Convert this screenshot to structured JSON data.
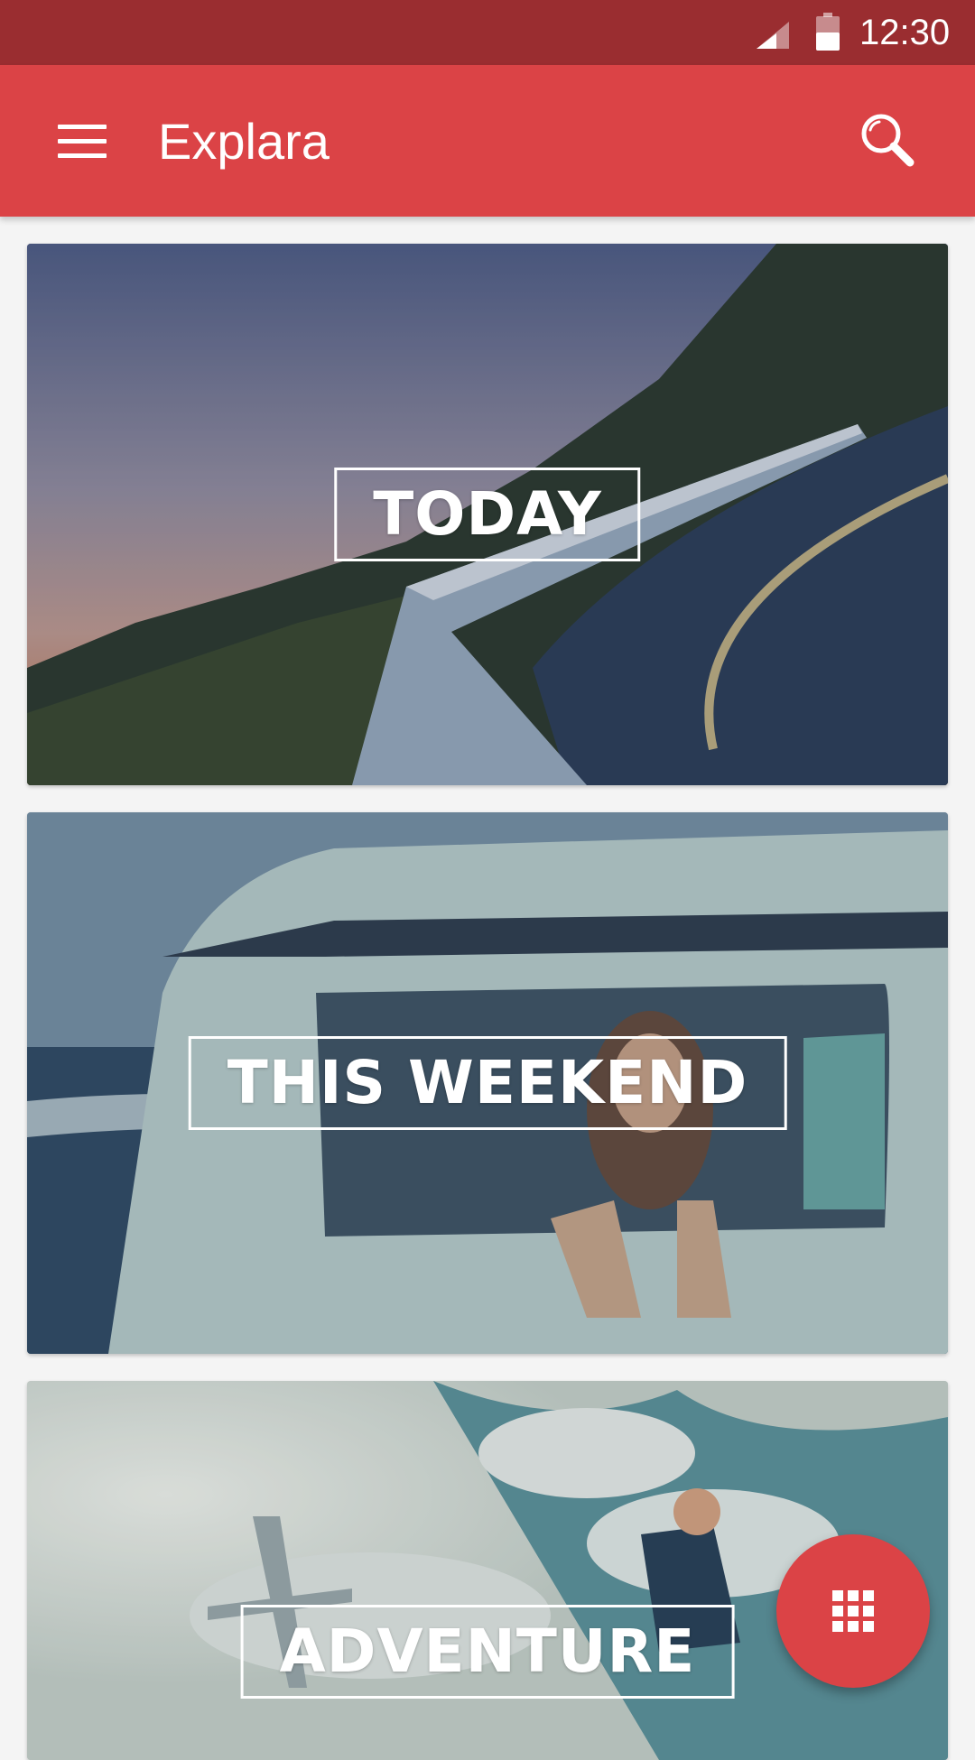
{
  "status_bar": {
    "time": "12:30",
    "signal_icon": "cell-signal-icon",
    "battery_icon": "battery-icon"
  },
  "app_bar": {
    "title": "Explara",
    "menu_icon": "hamburger-menu-icon",
    "search_icon": "search-icon",
    "color": "#db4346"
  },
  "cards": [
    {
      "label": "TODAY"
    },
    {
      "label": "THIS WEEKEND"
    },
    {
      "label": "ADVENTURE"
    }
  ],
  "fab": {
    "icon": "grid-apps-icon",
    "color": "#db4346"
  },
  "colors": {
    "status_bar": "#9a2d30",
    "background": "#f4f4f4"
  }
}
